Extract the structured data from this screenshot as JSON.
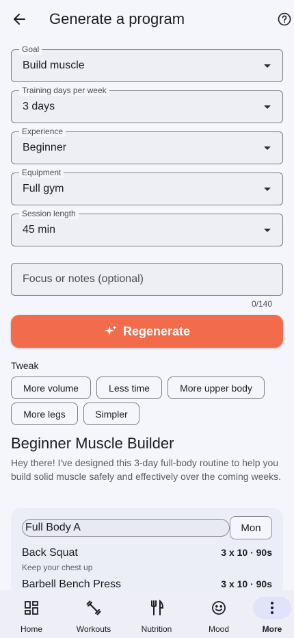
{
  "appbar": {
    "title": "Generate a program"
  },
  "fields": {
    "goal": {
      "label": "Goal",
      "value": "Build muscle"
    },
    "days": {
      "label": "Training days per week",
      "value": "3 days"
    },
    "experience": {
      "label": "Experience",
      "value": "Beginner"
    },
    "equipment": {
      "label": "Equipment",
      "value": "Full gym"
    },
    "session": {
      "label": "Session length",
      "value": "45 min"
    }
  },
  "notes": {
    "placeholder": "Focus or notes (optional)",
    "counter": "0/140"
  },
  "regenerate_label": "Regenerate",
  "tweak": {
    "label": "Tweak",
    "chips": [
      "More volume",
      "Less time",
      "More upper body",
      "More legs",
      "Simpler"
    ]
  },
  "program": {
    "title": "Beginner Muscle Builder",
    "description": "Hey there! I've designed this 3-day full-body routine to help you build solid muscle safely and effectively over the coming weeks."
  },
  "day_card": {
    "name": "Full Body A",
    "day": "Mon",
    "exercises": [
      {
        "name": "Back Squat",
        "sets": "3 x 10  ·  90s",
        "note": "Keep your chest up"
      },
      {
        "name": "Barbell Bench Press",
        "sets": "3 x 10  ·  90s",
        "note": ""
      }
    ]
  },
  "nav": [
    {
      "label": "Home",
      "icon": "dashboard-icon",
      "active": false
    },
    {
      "label": "Workouts",
      "icon": "dumbbell-icon",
      "active": false
    },
    {
      "label": "Nutrition",
      "icon": "utensils-icon",
      "active": false
    },
    {
      "label": "Mood",
      "icon": "smiley-icon",
      "active": false
    },
    {
      "label": "More",
      "icon": "more-vert-icon",
      "active": true
    }
  ],
  "colors": {
    "accent": "#f26c4b",
    "background": "#f5f6fc",
    "nav_active": "#dfe3fb"
  }
}
